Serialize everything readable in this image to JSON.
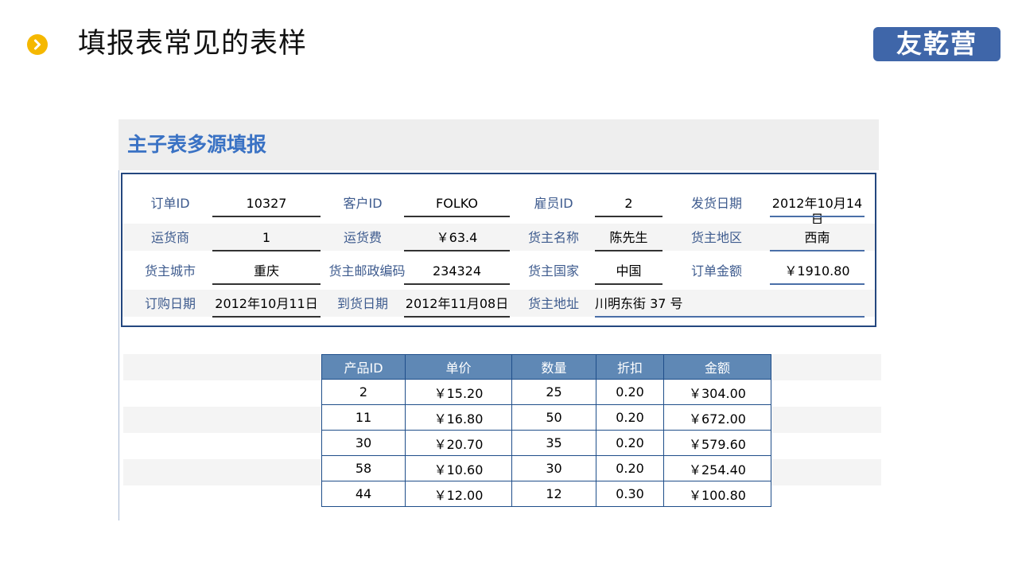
{
  "slide": {
    "title": "填报表常见的表样",
    "logo_text": "友乾营"
  },
  "colors": {
    "bullet": "#f5b800",
    "logo_bg": "#3f66a9",
    "panel_title": "#3a72c4",
    "form_border": "#24477f",
    "table_header": "#5f88b5"
  },
  "icons": {
    "bullet": "chevron-right-icon"
  },
  "report": {
    "title": "主子表多源填报",
    "form": {
      "rows": [
        [
          {
            "label": "订单ID",
            "value": "10327"
          },
          {
            "label": "客户ID",
            "value": "FOLKO"
          },
          {
            "label": "雇员ID",
            "value": "2"
          },
          {
            "label": "发货日期",
            "value": "2012年10月14日"
          }
        ],
        [
          {
            "label": "运货商",
            "value": "1"
          },
          {
            "label": "运货费",
            "value": "￥63.4"
          },
          {
            "label": "货主名称",
            "value": "陈先生"
          },
          {
            "label": "货主地区",
            "value": "西南"
          }
        ],
        [
          {
            "label": "货主城市",
            "value": "重庆"
          },
          {
            "label": "货主邮政编码",
            "value": "234324"
          },
          {
            "label": "货主国家",
            "value": "中国"
          },
          {
            "label": "订单金额",
            "value": "￥1910.80"
          }
        ],
        [
          {
            "label": "订购日期",
            "value": "2012年10月11日"
          },
          {
            "label": "到货日期",
            "value": "2012年11月08日"
          },
          {
            "label": "货主地址",
            "value": "川明东街 37 号"
          }
        ]
      ]
    },
    "detail": {
      "headers": [
        "产品ID",
        "单价",
        "数量",
        "折扣",
        "金额"
      ],
      "rows": [
        [
          "2",
          "￥15.20",
          "25",
          "0.20",
          "￥304.00"
        ],
        [
          "11",
          "￥16.80",
          "50",
          "0.20",
          "￥672.00"
        ],
        [
          "30",
          "￥20.70",
          "35",
          "0.20",
          "￥579.60"
        ],
        [
          "58",
          "￥10.60",
          "30",
          "0.20",
          "￥254.40"
        ],
        [
          "44",
          "￥12.00",
          "12",
          "0.30",
          "￥100.80"
        ]
      ]
    }
  }
}
